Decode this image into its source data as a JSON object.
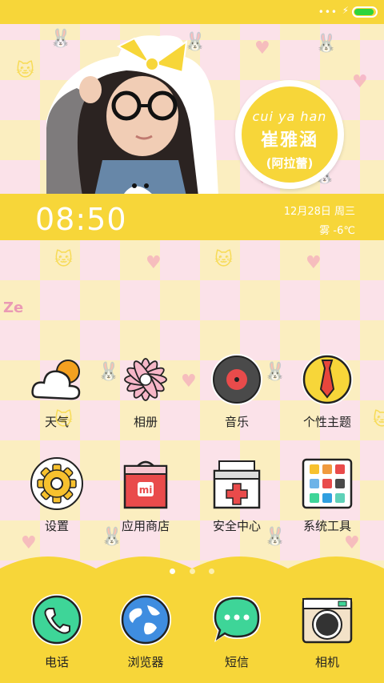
{
  "status": {
    "dots": "•••",
    "charging_icon": "bolt-icon",
    "battery_color": "#2fd43c"
  },
  "badge": {
    "pinyin": "cui ya han",
    "name": "崔雅涵",
    "alias": "(阿拉蕾)"
  },
  "clock": {
    "time": "08:50",
    "date": "12月28日 周三",
    "weather": "雾 -6℃"
  },
  "watermark": "Ze",
  "apps": [
    {
      "label": "天气",
      "icon": "weather-icon"
    },
    {
      "label": "相册",
      "icon": "flower-icon"
    },
    {
      "label": "音乐",
      "icon": "vinyl-icon"
    },
    {
      "label": "个性主题",
      "icon": "tie-icon"
    },
    {
      "label": "设置",
      "icon": "gear-icon"
    },
    {
      "label": "应用商店",
      "icon": "bag-icon"
    },
    {
      "label": "安全中心",
      "icon": "first-aid-icon"
    },
    {
      "label": "系统工具",
      "icon": "toolbox-icon"
    }
  ],
  "dock": [
    {
      "label": "电话",
      "icon": "phone-icon"
    },
    {
      "label": "浏览器",
      "icon": "globe-icon"
    },
    {
      "label": "短信",
      "icon": "message-icon"
    },
    {
      "label": "相机",
      "icon": "camera-icon"
    }
  ],
  "colors": {
    "theme_yellow": "#f7d639",
    "pink": "#f5a9bd",
    "green": "#3ed598"
  }
}
